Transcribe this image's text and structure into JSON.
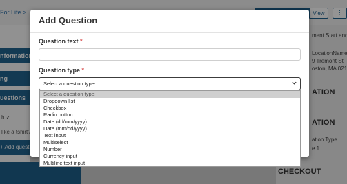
{
  "background": {
    "breadcrumb": "For Life  >",
    "view_button": "View",
    "icon_button": "⋮",
    "sidebar": {
      "items": [
        "nformation",
        "ng",
        "uestions"
      ],
      "snippets": [
        "h ✓",
        "like a tshirt?"
      ],
      "add_button": "+ Add question"
    },
    "right": {
      "lines": [
        "ment Start and E",
        "LocationName",
        "9 Tremont St",
        "oston, MA 0211"
      ],
      "headings": [
        "ATION",
        "ATION",
        "CHECKOUT"
      ],
      "details": [
        "ation Type",
        "e 1"
      ]
    }
  },
  "modal": {
    "title": "Add Question",
    "question_text_label": "Question text",
    "question_text_value": "",
    "required_marker": "*",
    "question_type_label": "Question type",
    "select_value": "Select a question type",
    "options": [
      "Select a question type",
      "Dropdown list",
      "Checkbox",
      "Radio button",
      "Date (dd/mm/yyyy)",
      "Date (mm/dd/yyyy)",
      "Text input",
      "Multiselect",
      "Number",
      "Currency input",
      "Multiline text input"
    ],
    "selected_index": 0
  },
  "colors": {
    "primary": "#21648f",
    "required": "#d43a3a",
    "overlay": "rgba(0,0,0,0.42)"
  }
}
